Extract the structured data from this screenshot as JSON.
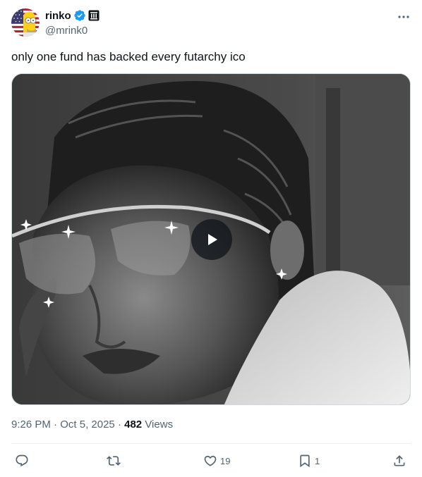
{
  "author": {
    "display_name": "rinko",
    "handle": "@mrink0",
    "verified": true,
    "avatar_icon": "simpsons-character-flag-avatar",
    "affiliation_icon": "building-affiliate-icon"
  },
  "tweet": {
    "text": "only one fund has backed every futarchy ico",
    "media_type": "video",
    "media_description_icon": "play-icon"
  },
  "meta": {
    "time": "9:26 PM",
    "separator": " · ",
    "date": "Oct 5, 2025",
    "views_count": "482",
    "views_label": "Views"
  },
  "actions": {
    "reply_count": "",
    "retweet_count": "",
    "like_count": "19",
    "bookmark_count": "1"
  },
  "colors": {
    "text_primary": "#0f1419",
    "text_secondary": "#536471",
    "verified_blue": "#1d9bf0",
    "divider": "#eff3f4"
  }
}
